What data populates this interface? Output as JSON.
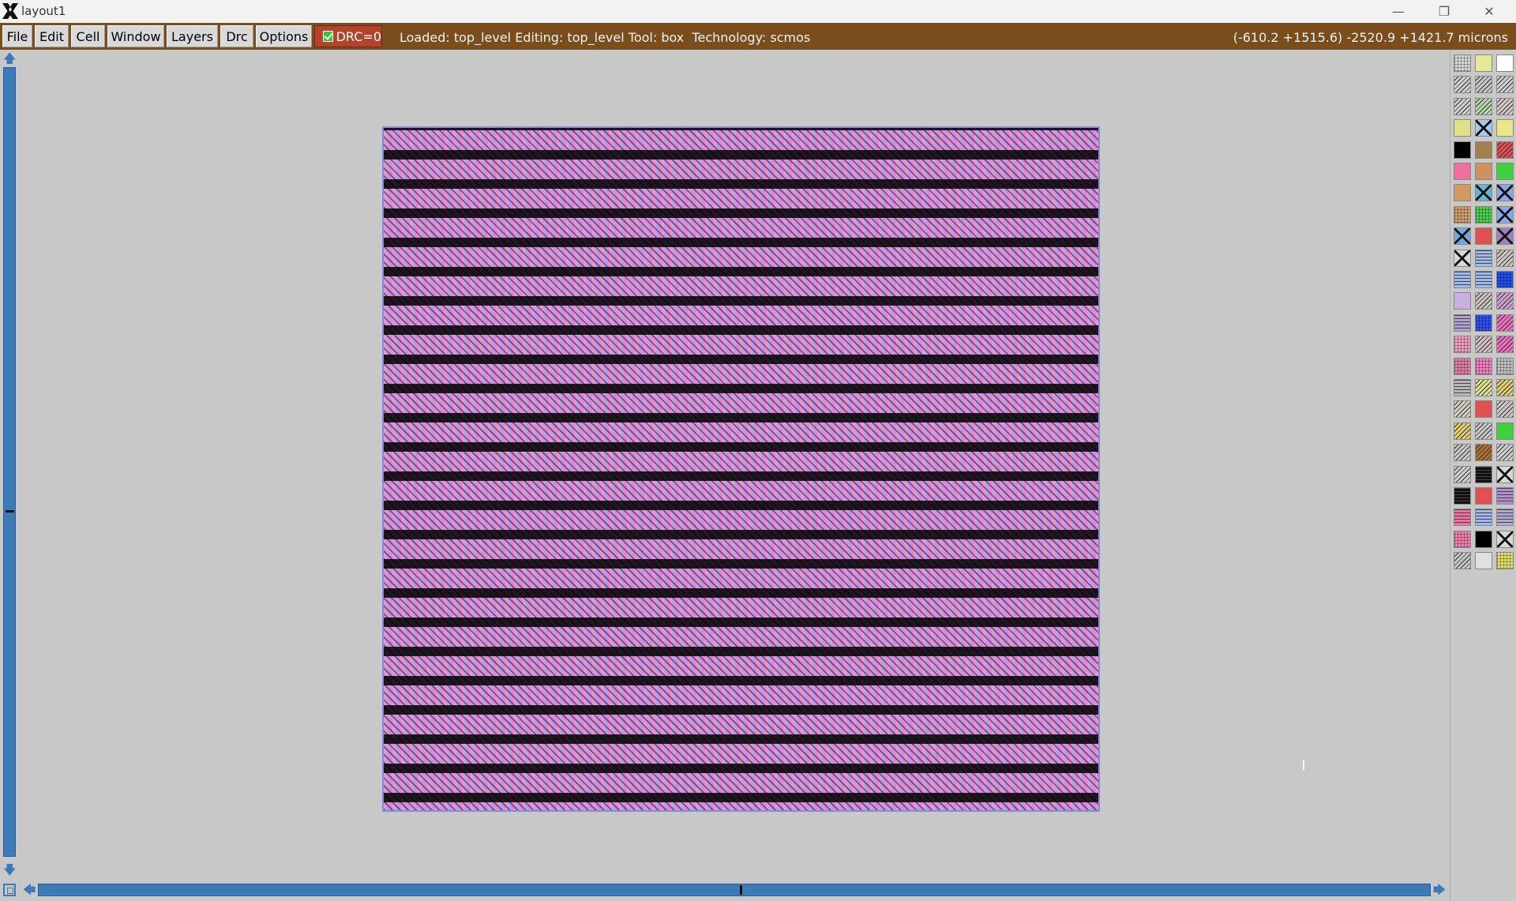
{
  "window": {
    "title": "layout1",
    "buttons": [
      "minimize",
      "restore",
      "close"
    ]
  },
  "menubar": {
    "items": [
      "File",
      "Edit",
      "Cell",
      "Window",
      "Layers",
      "Drc",
      "Options"
    ],
    "drc_label": "DRC=0",
    "drc_checked": true,
    "status": "Loaded: top_level Editing: top_level Tool: box  Technology: scmos",
    "coordinates": "(-610.2 +1515.6) -2520.9 +1421.7 microns",
    "bar_color": "#7a4e1c"
  },
  "canvas": {
    "background": "#c8c8c8",
    "cell": "top_level"
  },
  "palette": {
    "icon_names": [
      "grid-layer-icon",
      "yellow-layer-icon",
      "outline-layer-icon",
      "hatch-layer-icon",
      "hatch-light-layer-icon",
      "hatch-dark-layer-icon",
      "hatch-layer-icon",
      "green-hatch-layer-icon",
      "hatch-layer-icon",
      "yellow-layer-icon",
      "blue-x-layer-icon",
      "yellow-layer-icon",
      "black-layer-icon",
      "brown-layer-icon",
      "red-hatch-layer-icon",
      "pink-layer-icon",
      "tan-layer-icon",
      "green-layer-icon",
      "tan-layer-icon",
      "teal-x-layer-icon",
      "blue-x-layer-icon",
      "tan-dotted-layer-icon",
      "green-dotted-layer-icon",
      "blue-x-layer-icon",
      "blue-x-layer-icon",
      "red-layer-icon",
      "purple-x-layer-icon",
      "black-x-layer-icon",
      "blue-stripe-layer-icon",
      "hatch-layer-icon",
      "blue-stripe-layer-icon",
      "blue-stripe-layer-icon",
      "blue-check-layer-icon",
      "lavender-layer-icon",
      "hatch-layer-icon",
      "purple-hatch-layer-icon",
      "purple-stripe-layer-icon",
      "blue-check-layer-icon",
      "pink-hatch-layer-icon",
      "pink-dotted-layer-icon",
      "hatch-layer-icon",
      "pink-hatch-layer-icon",
      "pink-grid-layer-icon",
      "pink-dotted-layer-icon",
      "dot-grid-layer-icon",
      "grey-stripe-layer-icon",
      "yellow-hatch-layer-icon",
      "yellow-hatch-layer-icon",
      "hatch-layer-icon",
      "red-layer-icon",
      "hatch-layer-icon",
      "yellow-hatch-layer-icon",
      "hatch-layer-icon",
      "green-layer-icon",
      "hatch-layer-icon",
      "brown-hatch-layer-icon",
      "hatch-layer-icon",
      "hatch-layer-icon",
      "black-stripe-layer-icon",
      "black-x-layer-icon",
      "black-stripe-layer-icon",
      "red-layer-icon",
      "purple-stripe-layer-icon",
      "pink-stripe-layer-icon",
      "blue-stripe-layer-icon",
      "purple-stripe-layer-icon",
      "pink-grid-layer-icon",
      "black-layer-icon",
      "black-x-layer-icon",
      "hatch-layer-icon",
      "dot-layer-icon",
      "yellow-dotted-layer-icon"
    ],
    "colors": [
      "#d8d8d8",
      "#e8e89a",
      "#ffffff",
      "#d0d0d0",
      "#c8c8c8",
      "#d0d0d0",
      "#d0d0d0",
      "#b8d8b0",
      "#d8c8c8",
      "#e0e08a",
      "#a8c8e8",
      "#e8e88a",
      "#000000",
      "#a08050",
      "#e05050",
      "#f070a0",
      "#d09060",
      "#40d040",
      "#d09a60",
      "#60b8d0",
      "#8aa8e8",
      "#d0a070",
      "#50d050",
      "#8aa8e8",
      "#70a8e0",
      "#e05050",
      "#a080c0",
      "#d8d8d8",
      "#a0b8f0",
      "#d0c8c0",
      "#a0b8f0",
      "#a0b8f0",
      "#2050f0",
      "#c8b0e0",
      "#d0c0c0",
      "#d0a0d0",
      "#b0a0d0",
      "#3050f0",
      "#f070c0",
      "#f0a0c0",
      "#d0c0c0",
      "#f070c0",
      "#e080a8",
      "#f080c0",
      "#c0c0c0",
      "#b8b8b8",
      "#e0e090",
      "#e0d070",
      "#d8d0c8",
      "#e05050",
      "#d0c8c8",
      "#e0d070",
      "#c8c8c8",
      "#40d040",
      "#c8c8c8",
      "#b07030",
      "#d0d0d0",
      "#d0d0d0",
      "#101010",
      "#d8d8d8",
      "#101010",
      "#e05050",
      "#b090d0",
      "#f070a0",
      "#a0b8f0",
      "#b0a8d0",
      "#f080b0",
      "#000000",
      "#d8d8d8",
      "#c8c8c8",
      "#e0e0e0",
      "#e0e070"
    ]
  }
}
